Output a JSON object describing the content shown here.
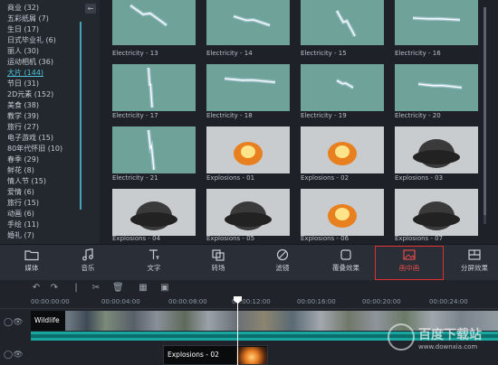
{
  "sidebar": {
    "collapse_icon": "arrow-left-icon",
    "categories": [
      {
        "label": "商业 (32)"
      },
      {
        "label": "五彩纸屑 (7)"
      },
      {
        "label": "生日 (17)"
      },
      {
        "label": "日式毕业礼 (6)"
      },
      {
        "label": "丽人 (30)"
      },
      {
        "label": "运动相机 (36)"
      },
      {
        "label": "大片 (144)",
        "active": true
      },
      {
        "label": "节日 (31)"
      },
      {
        "label": "2D元素 (152)"
      },
      {
        "label": "美食 (38)"
      },
      {
        "label": "教学 (39)"
      },
      {
        "label": "旅行 (27)"
      },
      {
        "label": "电子游戏 (15)"
      },
      {
        "label": "80年代怀旧 (10)"
      },
      {
        "label": "春季 (29)"
      },
      {
        "label": "鲜花 (8)"
      },
      {
        "label": "情人节 (15)"
      },
      {
        "label": "爱情 (6)"
      },
      {
        "label": "旅行 (15)"
      },
      {
        "label": "动画 (6)"
      },
      {
        "label": "手绘 (11)"
      },
      {
        "label": "婚礼 (7)"
      }
    ]
  },
  "grid": {
    "items": [
      {
        "label": "Electricity - 13"
      },
      {
        "label": "Electricity - 14"
      },
      {
        "label": "Electricity - 15"
      },
      {
        "label": "Electricity - 16"
      },
      {
        "label": "Electricity - 17"
      },
      {
        "label": "Electricity - 18"
      },
      {
        "label": "Electricity - 19"
      },
      {
        "label": "Electricity - 20"
      },
      {
        "label": "Electricity - 21"
      },
      {
        "label": "Explosions - 01"
      },
      {
        "label": "Explosions - 02"
      },
      {
        "label": "Explosions - 03"
      },
      {
        "label": "Explosions - 04"
      },
      {
        "label": "Explosions - 05"
      },
      {
        "label": "Explosions - 06"
      },
      {
        "label": "Explosions - 07"
      }
    ]
  },
  "tabs": [
    {
      "label": "媒体",
      "icon": "folder-icon"
    },
    {
      "label": "音乐",
      "icon": "music-note-icon"
    },
    {
      "label": "文字",
      "icon": "text-icon"
    },
    {
      "label": "转场",
      "icon": "transition-icon"
    },
    {
      "label": "滤镜",
      "icon": "filter-icon"
    },
    {
      "label": "覆叠效果",
      "icon": "overlay-icon"
    },
    {
      "label": "画中画",
      "icon": "image-icon",
      "active": true
    },
    {
      "label": "分屏效果",
      "icon": "split-screen-icon"
    }
  ],
  "timeline": {
    "timecodes": [
      "00:00:00:00",
      "00:00:04:00",
      "00:00:08:00",
      "00:00:12:00",
      "00:00:16:00",
      "00:00:20:00",
      "00:00:24:00"
    ],
    "track1_title": "Wildlife",
    "track2_clip": "Explosions - 02"
  },
  "watermark": {
    "title": "百度下载站",
    "url": "www.downxia.com"
  },
  "colors": {
    "accent": "#4fc3d9",
    "highlight_box": "#e02d2d",
    "audio_track": "#1aa6a0"
  }
}
